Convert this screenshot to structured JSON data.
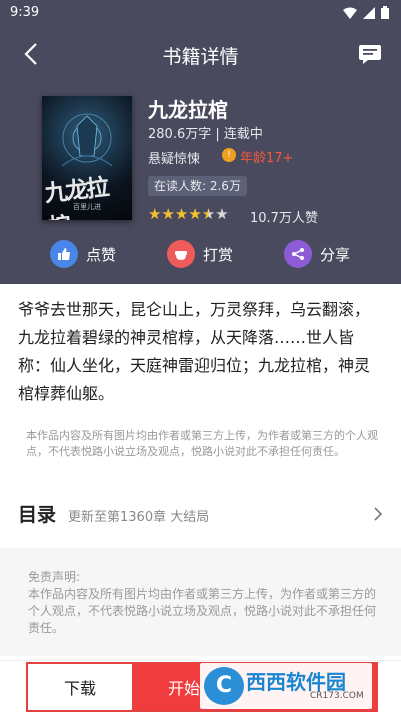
{
  "status": {
    "time": "9:39"
  },
  "topbar": {
    "title": "书籍详情"
  },
  "book": {
    "cover_title": "九龙拉棺",
    "cover_author": "百里儿进",
    "name": "九龙拉棺",
    "meta": "280.6万字 | 连载中",
    "genre": "悬疑惊悚",
    "age": "年龄17+",
    "readers": "在读人数: 2.6万",
    "rating": 4.5,
    "stars_text": {
      "on": "★★★★",
      "half": "★",
      "off": "★"
    },
    "likes": "10.7万人赞"
  },
  "actions": [
    {
      "label": "点赞",
      "icon": "thumbs-up-icon",
      "color": "#4a86e8"
    },
    {
      "label": "打赏",
      "icon": "gift-icon",
      "color": "#ef5b5b"
    },
    {
      "label": "分享",
      "icon": "share-icon",
      "color": "#8e5bd6"
    }
  ],
  "description": "爷爷去世那天，昆仑山上，万灵祭拜，乌云翻滚，九龙拉着碧绿的神灵棺椁，从天降落……世人皆称：仙人坐化，天庭神雷迎归位；九龙拉棺，神灵棺椁葬仙躯。",
  "notice": "本作品内容及所有图片均由作者或第三方上传，为作者或第三方的个人观点，不代表悦路小说立场及观点，悦路小说对此不承担任何责任。",
  "toc": {
    "title": "目录",
    "update": "更新至第1360章 大结局"
  },
  "disclaimer": {
    "title": "免责声明:",
    "body": "本作品内容及所有图片均由作者或第三方上传，为作者或第三方的个人观点，不代表悦路小说立场及观点，悦路小说对此不承担任何责任。"
  },
  "bottom": {
    "download": "下载",
    "read": "开始阅读"
  },
  "watermark": {
    "logo": "C",
    "text": "西西软件园",
    "url": "CR173.COM"
  },
  "colors": {
    "header_bg": "#4a4a5e",
    "accent_red": "#f03c3c",
    "star": "#f2c230"
  }
}
